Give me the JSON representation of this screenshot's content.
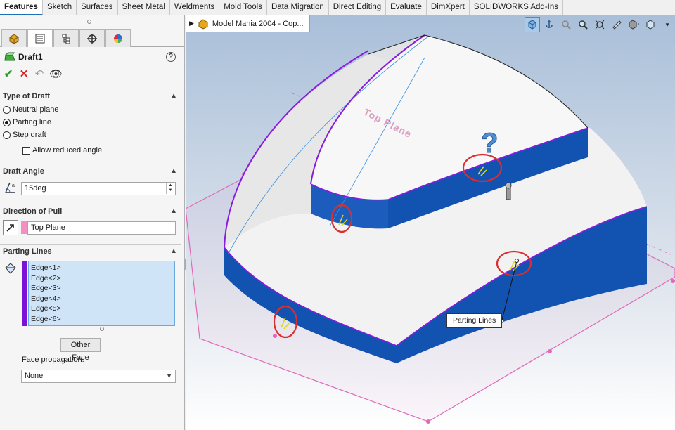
{
  "tabs": [
    "Features",
    "Sketch",
    "Surfaces",
    "Sheet Metal",
    "Weldments",
    "Mold Tools",
    "Data Migration",
    "Direct Editing",
    "Evaluate",
    "DimXpert",
    "SOLIDWORKS Add-Ins"
  ],
  "active_tab": "Features",
  "manager_tabs": [
    "featuremanager-icon",
    "propertymanager-icon",
    "configurationmanager-icon",
    "dimxpertmanager-icon",
    "displaymanager-icon"
  ],
  "feature": {
    "title": "Draft1",
    "help": "?"
  },
  "type_of_draft": {
    "header": "Type of Draft",
    "options": [
      "Neutral plane",
      "Parting line",
      "Step draft"
    ],
    "selected": "Parting line",
    "allow_reduced_angle": "Allow reduced angle"
  },
  "draft_angle": {
    "header": "Draft Angle",
    "value": "15deg"
  },
  "direction_of_pull": {
    "header": "Direction of Pull",
    "value": "Top Plane",
    "color": "#f48fc4"
  },
  "parting_lines": {
    "header": "Parting Lines",
    "edges": [
      "Edge<1>",
      "Edge<2>",
      "Edge<3>",
      "Edge<4>",
      "Edge<5>",
      "Edge<6>"
    ],
    "color": "#7b12d8",
    "other_face": "Other Face",
    "face_propagation_label": "Face propagation:",
    "face_propagation_value": "None"
  },
  "viewport": {
    "breadcrumb": "Model Mania 2004 - Cop...",
    "plane_label": "Top Plane",
    "callout": "Parting Lines",
    "hud_icons": [
      "view-orientation-icon",
      "anchor-icon",
      "zoom-to-fit-icon",
      "zoom-to-area-icon",
      "previous-view-icon",
      "section-view-icon",
      "display-style-icon",
      "hide-show-icon",
      "scene-icon"
    ],
    "colors": {
      "body_side": "#1252b0",
      "body_top": "#f4f4f4",
      "edge_highlight": "#8a1be0",
      "plane": "#e06ab8",
      "marker": "#d83030"
    }
  }
}
